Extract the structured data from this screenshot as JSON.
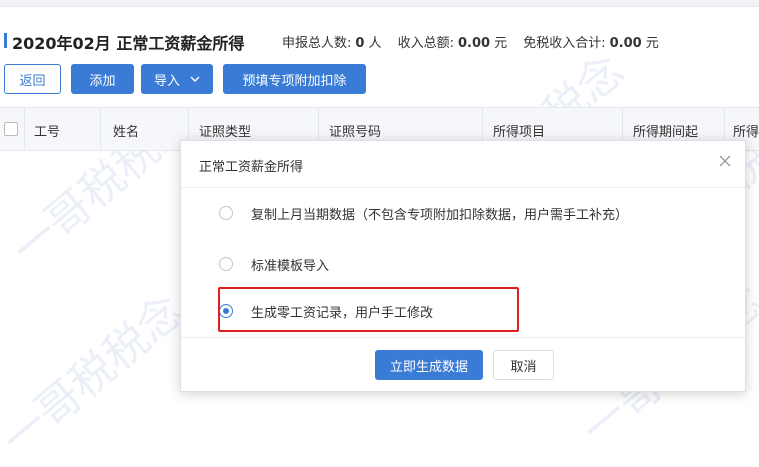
{
  "page": {
    "title": "2020年02月 正常工资薪金所得",
    "summary": {
      "declare_count_label": "申报总人数:",
      "declare_count_value": "0",
      "declare_count_unit": "人",
      "income_label": "收入总额:",
      "income_value": "0.00",
      "income_unit": "元",
      "taxfree_label": "免税收入合计:",
      "taxfree_value": "0.00",
      "taxfree_unit": "元"
    }
  },
  "toolbar": {
    "back_label": "返回",
    "add_label": "添加",
    "import_label": "导入",
    "prefill_label": "预填专项附加扣除"
  },
  "table": {
    "columns": [
      "工号",
      "姓名",
      "证照类型",
      "证照号码",
      "所得项目",
      "所得期间起",
      "所得"
    ]
  },
  "watermark": {
    "text": "一哥税税念"
  },
  "dialog": {
    "title": "正常工资薪金所得",
    "options": [
      {
        "label": "复制上月当期数据（不包含专项附加扣除数据，用户需手工补充）",
        "checked": false
      },
      {
        "label": "标准模板导入",
        "checked": false
      },
      {
        "label": "生成零工资记录，用户手工修改",
        "checked": true
      }
    ],
    "confirm_label": "立即生成数据",
    "cancel_label": "取消"
  },
  "colors": {
    "accent": "#3a7bd5",
    "highlight": "#e02020"
  },
  "icons": {
    "close": "close-icon",
    "import_dropdown": "chevron-down-icon"
  }
}
